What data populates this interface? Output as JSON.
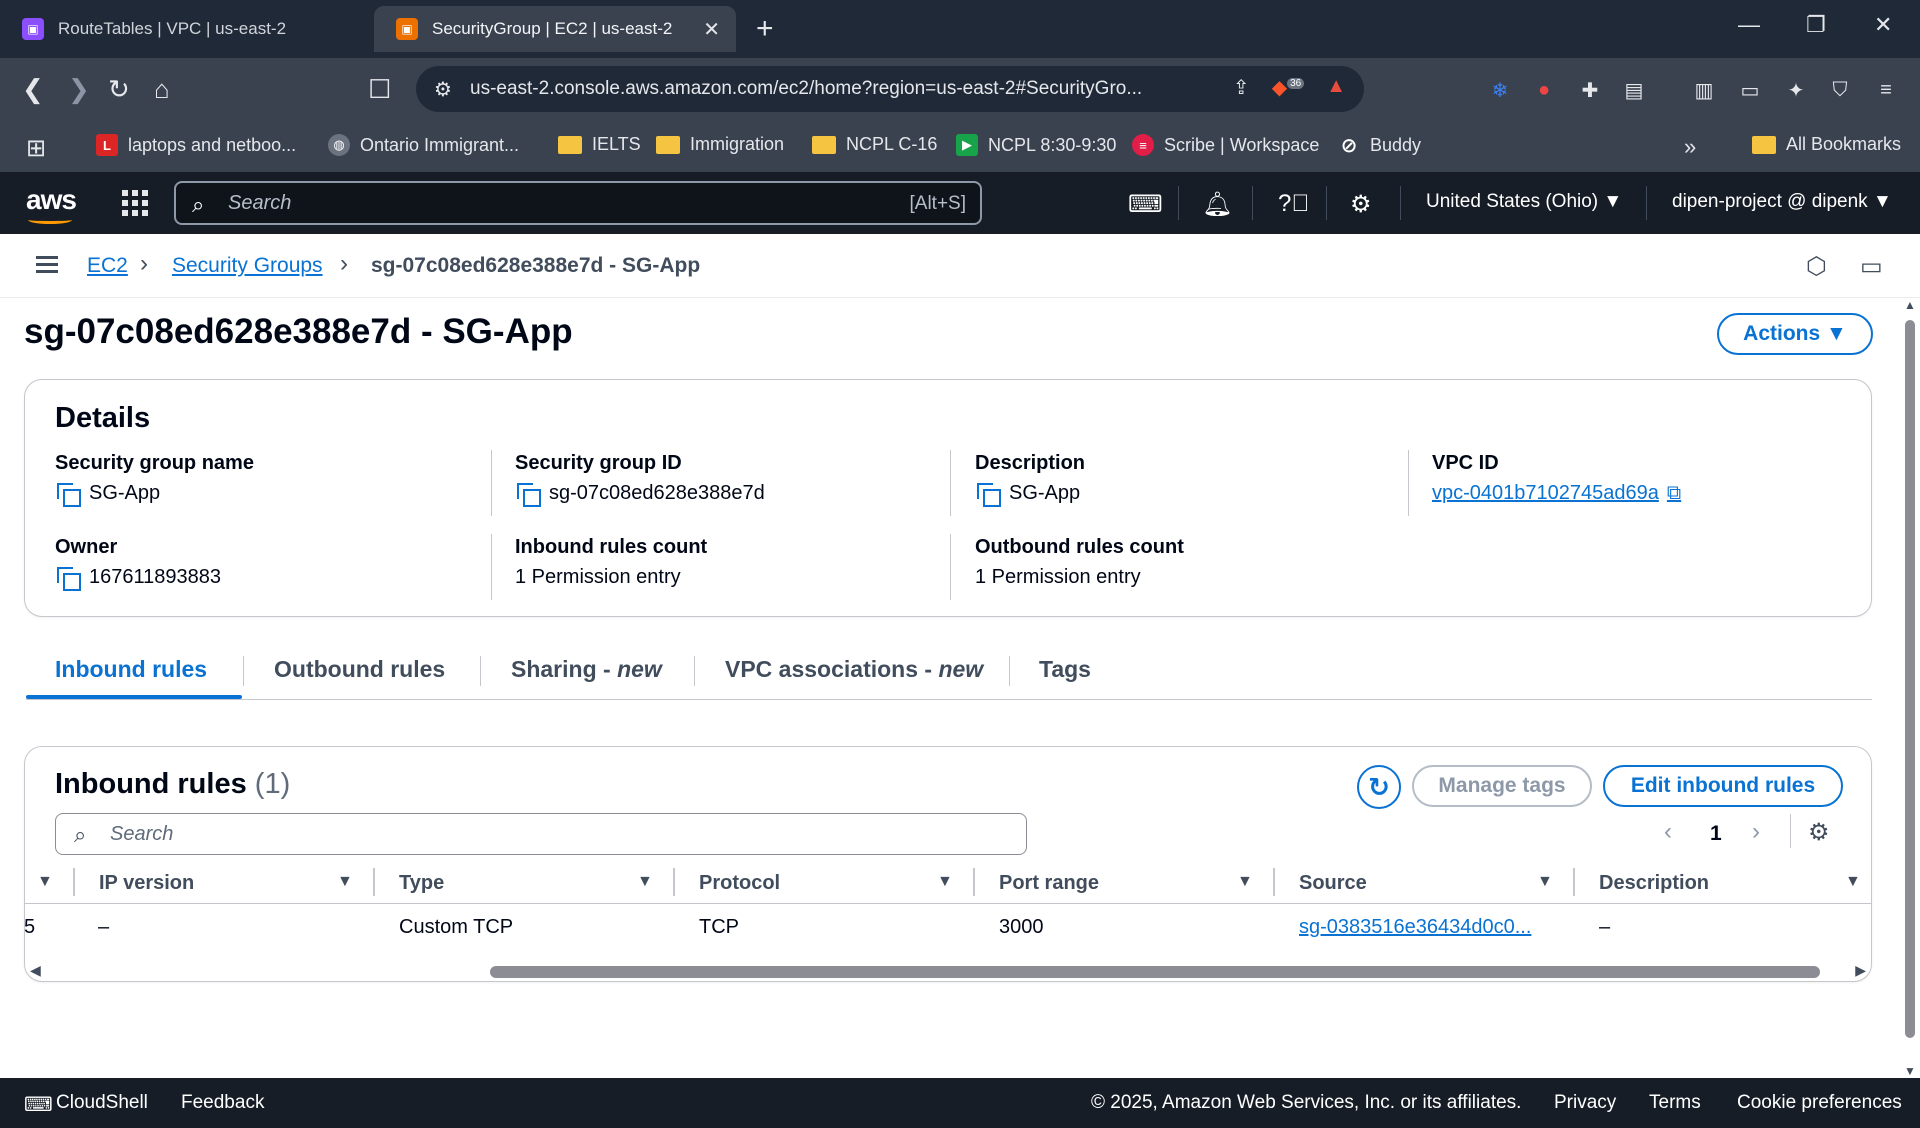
{
  "browser": {
    "tabs": [
      {
        "title": "RouteTables | VPC | us-east-2"
      },
      {
        "title": "SecurityGroup | EC2 | us-east-2"
      }
    ],
    "url": "us-east-2.console.aws.amazon.com/ec2/home?region=us-east-2#SecurityGro...",
    "brave_badge": "36",
    "bookmarks": [
      {
        "label": "laptops and netboo...",
        "icon": "L"
      },
      {
        "label": "Ontario Immigrant..."
      },
      {
        "label": "IELTS"
      },
      {
        "label": "Immigration"
      },
      {
        "label": "NCPL C-16"
      },
      {
        "label": "NCPL 8:30-9:30"
      },
      {
        "label": "Scribe | Workspace"
      },
      {
        "label": "Buddy"
      }
    ],
    "all_bookmarks": "All Bookmarks"
  },
  "aws": {
    "logo": "aws",
    "search_placeholder": "Search",
    "search_shortcut": "[Alt+S]",
    "region": "United States (Ohio) ▼",
    "account": "dipen-project @ dipenk ▼"
  },
  "breadcrumb": {
    "items": [
      "EC2",
      "Security Groups",
      "sg-07c08ed628e388e7d - SG-App"
    ]
  },
  "page": {
    "title": "sg-07c08ed628e388e7d - SG-App",
    "actions_label": "Actions ▼"
  },
  "details": {
    "title": "Details",
    "sg_name_label": "Security group name",
    "sg_name": "SG-App",
    "sg_id_label": "Security group ID",
    "sg_id": "sg-07c08ed628e388e7d",
    "description_label": "Description",
    "description": "SG-App",
    "vpc_label": "VPC ID",
    "vpc_id": "vpc-0401b7102745ad69a",
    "owner_label": "Owner",
    "owner": "167611893883",
    "inbound_count_label": "Inbound rules count",
    "inbound_count": "1 Permission entry",
    "outbound_count_label": "Outbound rules count",
    "outbound_count": "1 Permission entry"
  },
  "tabs": {
    "inbound": "Inbound rules",
    "outbound": "Outbound rules",
    "sharing": "Sharing - ",
    "vpc_assoc": "VPC associations - ",
    "new": "new",
    "tags": "Tags"
  },
  "inbound": {
    "title": "Inbound rules",
    "count": "(1)",
    "manage_tags": "Manage tags",
    "edit_rules": "Edit inbound rules",
    "search_placeholder": "Search",
    "page": "1",
    "columns": [
      "IP version",
      "Type",
      "Protocol",
      "Port range",
      "Source",
      "Description"
    ],
    "row": {
      "clipped": "5",
      "ip_version": "–",
      "type": "Custom TCP",
      "protocol": "TCP",
      "port_range": "3000",
      "source": "sg-0383516e36434d0c0...",
      "description": "–"
    }
  },
  "footer": {
    "cloudshell": "CloudShell",
    "feedback": "Feedback",
    "copyright": "© 2025, Amazon Web Services, Inc. or its affiliates.",
    "privacy": "Privacy",
    "terms": "Terms",
    "cookies": "Cookie preferences"
  },
  "colors": {
    "link": "#0972d3",
    "aws_nav_bg": "#161d26",
    "chrome_bg": "#1f2937",
    "brand_orange": "#ff9900"
  }
}
